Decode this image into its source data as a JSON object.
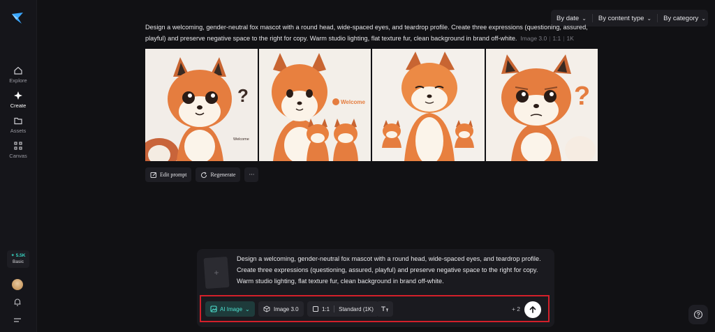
{
  "sidebar": {
    "items": [
      {
        "label": "Explore",
        "icon": "home-icon"
      },
      {
        "label": "Create",
        "icon": "sparkle-icon"
      },
      {
        "label": "Assets",
        "icon": "folder-icon"
      },
      {
        "label": "Canvas",
        "icon": "canvas-icon"
      }
    ],
    "credits": {
      "amount": "✦ 5.5K",
      "plan": "Basic"
    }
  },
  "filters": {
    "date": "By date",
    "content_type": "By content type",
    "category": "By category"
  },
  "generation": {
    "prompt": "Design a welcoming, gender-neutral fox mascot with a round head, wide-spaced eyes, and teardrop profile. Create three expressions (questioning, assured, playful) and preserve negative space to the right for copy. Warm studio lighting, flat texture fur, clean background in brand off-white.",
    "model": "Image 3.0",
    "ratio": "1:1",
    "resolution": "1K",
    "image_texts": {
      "img1_caption": "Welcome",
      "img1_mark": "?",
      "img2_badge": "Welcome",
      "img4_mark": "?"
    }
  },
  "actions": {
    "edit_prompt": "Edit prompt",
    "regenerate": "Regenerate",
    "more": "···"
  },
  "composer": {
    "text": "Design a welcoming, gender-neutral fox mascot with a round head, wide-spaced eyes, and teardrop profile. Create three expressions (questioning, assured, playful) and preserve negative space to the right for copy. Warm studio lighting, flat texture fur, clean background in brand off-white.",
    "add_reference": "+",
    "mode": "AI Image",
    "model": "Image 3.0",
    "ratio": "1:1",
    "quality": "Standard (1K)",
    "count": "+ 2"
  },
  "colors": {
    "accent": "#37d3c0",
    "highlight_border": "#d3202a",
    "fox_orange": "#e8793a"
  }
}
